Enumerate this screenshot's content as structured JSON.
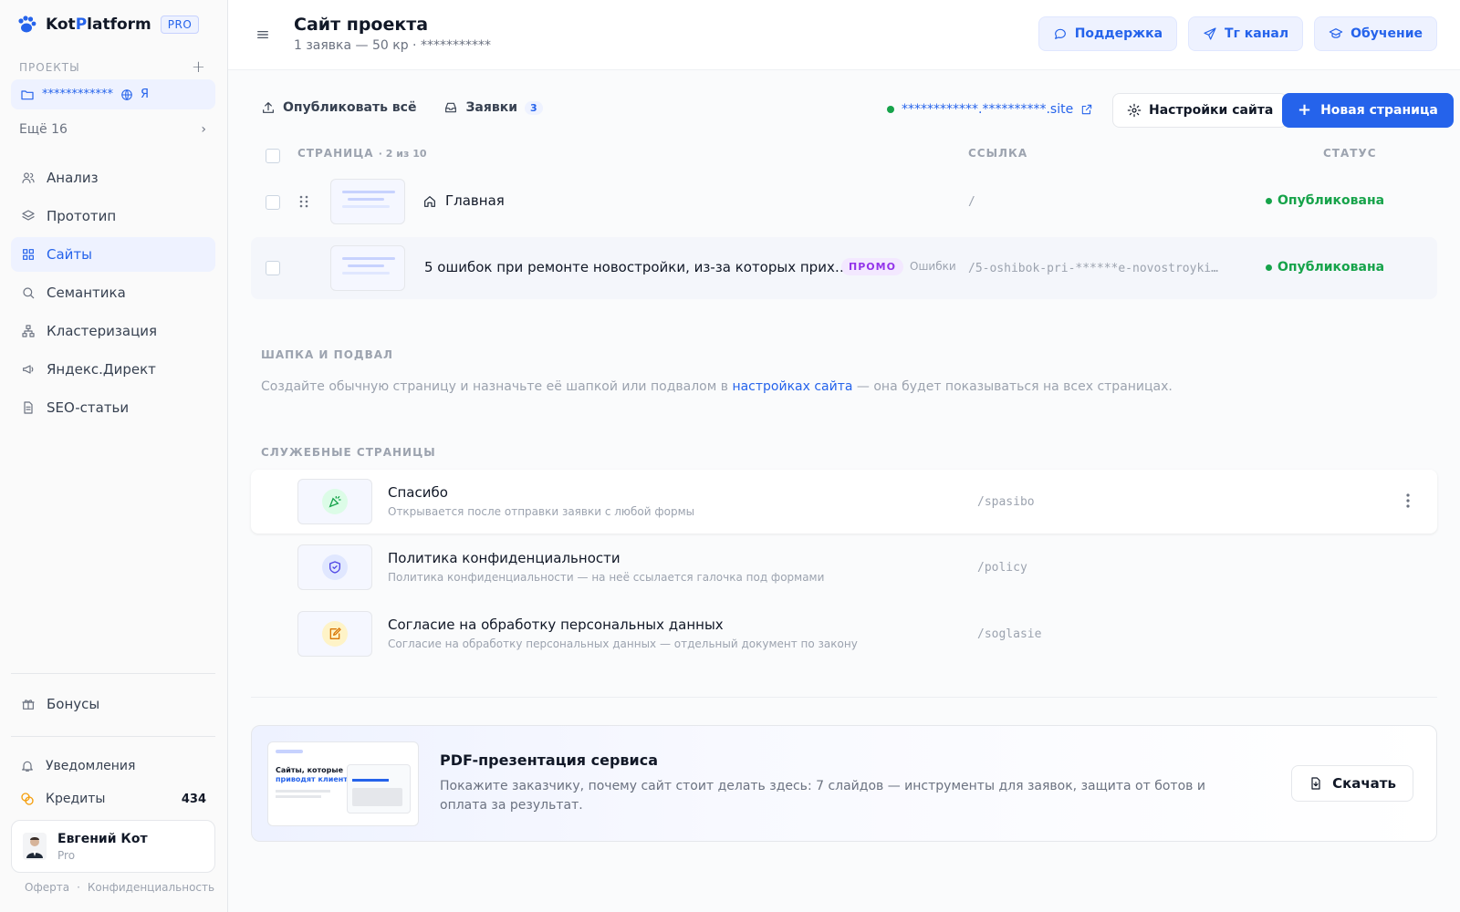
{
  "sidebar": {
    "logo": {
      "prefix": "Kot",
      "accent": "P",
      "suffix": "latform",
      "badge": "PRO"
    },
    "projects_label": "ПРОЕКТЫ",
    "project": {
      "name": "************",
      "lang": "Я"
    },
    "more_label": "Ещё 16",
    "nav": [
      {
        "label": "Анализ",
        "icon": "users-icon",
        "active": false
      },
      {
        "label": "Прототип",
        "icon": "layers-icon",
        "active": false
      },
      {
        "label": "Сайты",
        "icon": "grid-icon",
        "active": true
      },
      {
        "label": "Семантика",
        "icon": "search-icon",
        "active": false
      },
      {
        "label": "Кластеризация",
        "icon": "cluster-icon",
        "active": false
      },
      {
        "label": "Яндекс.Директ",
        "icon": "megaphone-icon",
        "active": false
      },
      {
        "label": "SEO-статьи",
        "icon": "document-icon",
        "active": false
      }
    ],
    "bonuses_label": "Бонусы",
    "notifications_label": "Уведомления",
    "credits_label": "Кредиты",
    "credits_value": "434",
    "user": {
      "name": "Евгений Кот",
      "plan": "Pro"
    },
    "footer": {
      "offer": "Оферта",
      "sep": "·",
      "privacy": "Конфиденциальность"
    }
  },
  "header": {
    "title": "Сайт проекта",
    "subtitle": "1 заявка — 50 кр · ***********",
    "buttons": {
      "support": "Поддержка",
      "telegram": "Тг канал",
      "learning": "Обучение"
    }
  },
  "toolbar": {
    "publish_all": "Опубликовать всё",
    "requests": "Заявки",
    "requests_count": "3",
    "domain": "************.**********.site",
    "settings": "Настройки сайта",
    "new_page": "Новая страница"
  },
  "table": {
    "col_page": "СТРАНИЦА",
    "col_page_count": "· 2 из 10",
    "col_link": "ССЫЛКА",
    "col_status": "СТАТУС",
    "rows": [
      {
        "name": "Главная",
        "link": "/",
        "status": "Опубликована"
      },
      {
        "name": "5 ошибок при ремонте новостройки, из-за которых прих…",
        "promo": "ПРОМО",
        "tag": "Ошибки",
        "link": "/5-oshibok-pri-******e-novostroyki…",
        "status": "Опубликована"
      }
    ]
  },
  "header_footer": {
    "label": "ШАПКА И ПОДВАЛ",
    "desc_before": "Создайте обычную страницу и назначьте её шапкой или подвалом в ",
    "desc_link": "настройках сайта",
    "desc_after": " — она будет показываться на всех страницах."
  },
  "service": {
    "label": "СЛУЖЕБНЫЕ СТРАНИЦЫ",
    "rows": [
      {
        "name": "Спасибо",
        "desc": "Открывается после отправки заявки с любой формы",
        "link": "/spasibo",
        "icon": "party-icon"
      },
      {
        "name": "Политика конфиденциальности",
        "desc": "Политика конфиденциальности — на неё ссылается галочка под формами",
        "link": "/policy",
        "icon": "shield-icon"
      },
      {
        "name": "Согласие на обработку персональных данных",
        "desc": "Согласие на обработку персональных данных — отдельный документ по закону",
        "link": "/soglasie",
        "icon": "edit-icon"
      }
    ]
  },
  "pdf": {
    "title": "PDF-презентация сервиса",
    "desc": "Покажите заказчику, почему сайт стоит делать здесь: 7 слайдов — инструменты для заявок, защита от ботов и оплата за результат.",
    "download": "Скачать",
    "thumb_headline_1": "Сайты, которые",
    "thumb_headline_2": "приводят клиентов"
  },
  "colors": {
    "accent": "#2563eb",
    "published": "#16a34a",
    "promo": "#9333ea"
  }
}
